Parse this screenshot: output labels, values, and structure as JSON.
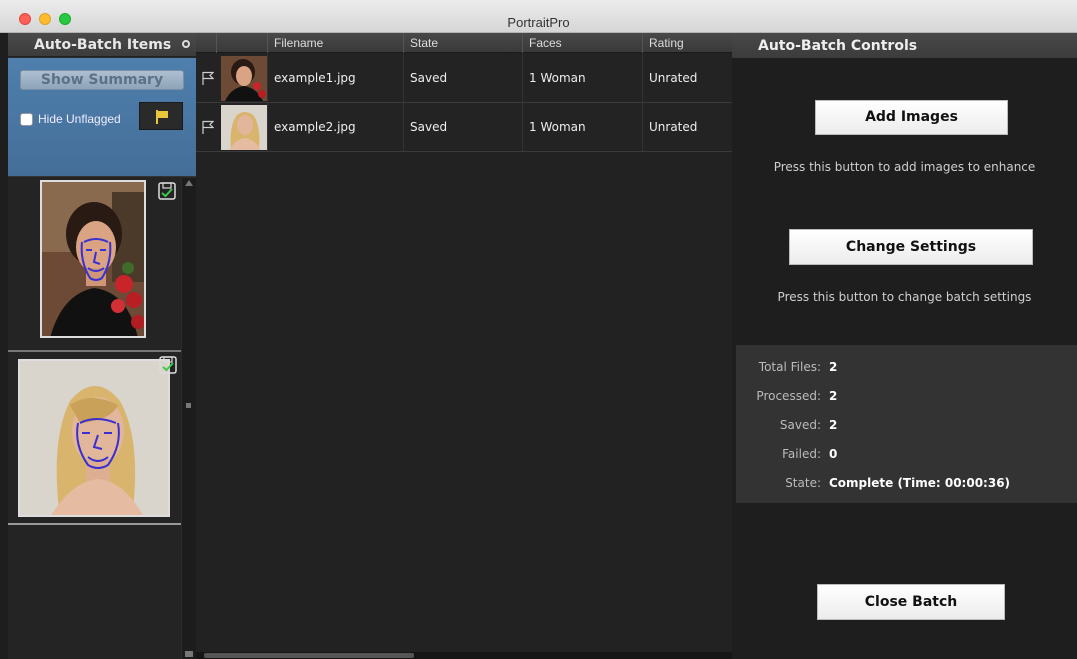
{
  "window": {
    "title": "PortraitPro"
  },
  "left_panel": {
    "title": "Auto-Batch Items",
    "show_summary_label": "Show Summary",
    "hide_unflagged_label": "Hide Unflagged",
    "hide_unflagged_checked": false,
    "thumbnails": [
      {
        "file": "example1.jpg",
        "saved": true
      },
      {
        "file": "example2.jpg",
        "saved": true
      }
    ]
  },
  "table": {
    "columns": [
      "Filename",
      "State",
      "Faces",
      "Rating"
    ],
    "rows": [
      {
        "filename": "example1.jpg",
        "state": "Saved",
        "faces": "1 Woman",
        "rating": "Unrated"
      },
      {
        "filename": "example2.jpg",
        "state": "Saved",
        "faces": "1 Woman",
        "rating": "Unrated"
      }
    ]
  },
  "right_panel": {
    "title": "Auto-Batch Controls",
    "add_images_label": "Add Images",
    "add_images_hint": "Press this button to add images to enhance",
    "change_settings_label": "Change Settings",
    "change_settings_hint": "Press this button to change batch settings",
    "stats": [
      {
        "label": "Total Files:",
        "value": "2"
      },
      {
        "label": "Processed:",
        "value": "2"
      },
      {
        "label": "Saved:",
        "value": "2"
      },
      {
        "label": "Failed:",
        "value": "0"
      },
      {
        "label": "State:",
        "value": "Complete (Time: 00:00:36)"
      }
    ],
    "close_batch_label": "Close Batch"
  },
  "colors": {
    "accent_blue": "#4a7aa8",
    "flag_yellow": "#e8c53a",
    "save_check_green": "#3ecb4a",
    "face_outline": "#3a2fd0"
  },
  "icons": [
    "flag-icon",
    "save-check-icon",
    "panel-menu-icon"
  ]
}
